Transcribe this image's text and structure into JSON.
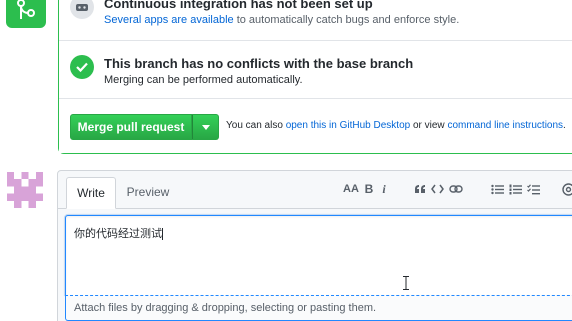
{
  "merge_status": {
    "ci": {
      "title": "Continuous integration has not been set up",
      "desc_link": "Several apps are available",
      "desc_rest": " to automatically catch bugs and enforce style."
    },
    "conflicts": {
      "title": "This branch has no conflicts with the base branch",
      "desc": "Merging can be performed automatically."
    },
    "merge_button_label": "Merge pull request",
    "hint_prefix": "You can also ",
    "hint_link_desktop": "open this in GitHub Desktop",
    "hint_middle": " or view ",
    "hint_link_cli": "command line instructions",
    "hint_suffix": "."
  },
  "comment": {
    "tabs": [
      "Write",
      "Preview"
    ],
    "toolbar": {
      "header_label": "AA",
      "bold_label": "B",
      "italic_label": "i",
      "icons": [
        "text-size-icon",
        "bold-icon",
        "italic-icon",
        "quote-icon",
        "code-icon",
        "link-icon",
        "unordered-list-icon",
        "ordered-list-icon",
        "task-list-icon",
        "mention-icon"
      ]
    },
    "text_value": "你的代码经过测试",
    "attach_hint": "Attach files by dragging & dropping, selecting or pasting them."
  },
  "colors": {
    "success": "#2cbe4e",
    "link": "#0366d6",
    "focus": "#2188ff",
    "avatar": "#d8a3d8"
  }
}
